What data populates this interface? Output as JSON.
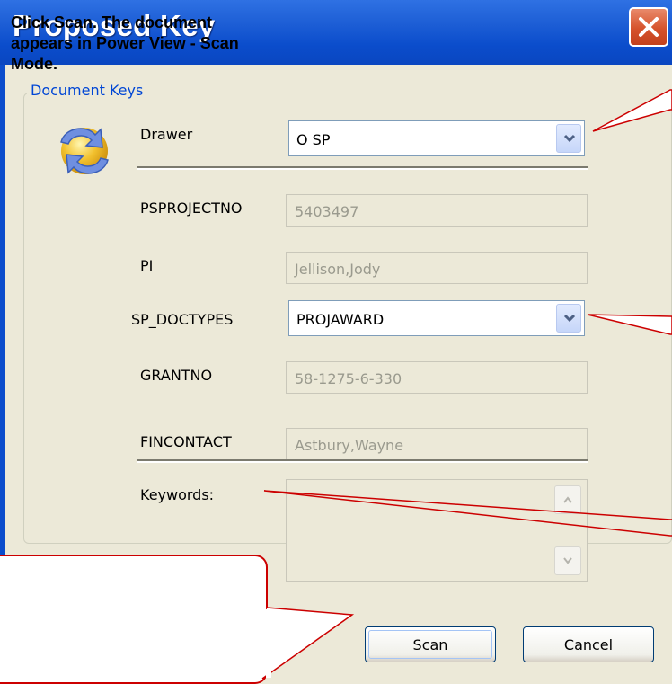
{
  "window": {
    "title": "Proposed Key",
    "close_icon": "close-icon"
  },
  "group": {
    "label": "Document Keys",
    "icon": "sync-arrows-icon"
  },
  "fields": {
    "drawer": {
      "label": "Drawer",
      "value": "O SP"
    },
    "psprojectno": {
      "label": "PSPROJECTNO",
      "value": "5403497"
    },
    "pi": {
      "label": "PI",
      "value": "Jellison,Jody"
    },
    "sp_doctypes": {
      "label": "SP_DOCTYPES",
      "value": "PROJAWARD"
    },
    "grantno": {
      "label": "GRANTNO",
      "value": "58-1275-6-330"
    },
    "fincontact": {
      "label": "FINCONTACT",
      "value": "Astbury,Wayne"
    },
    "keywords": {
      "label": "Keywords:",
      "value": ""
    }
  },
  "buttons": {
    "scan": "Scan",
    "cancel": "Cancel"
  },
  "callout": {
    "text": "Click Scan.  The document appears in Power View - Scan Mode."
  },
  "colors": {
    "titlebar": "#0b4dcc",
    "dialog_bg": "#ece9d8",
    "callout_border": "#cc0000",
    "group_label": "#0046d5"
  }
}
